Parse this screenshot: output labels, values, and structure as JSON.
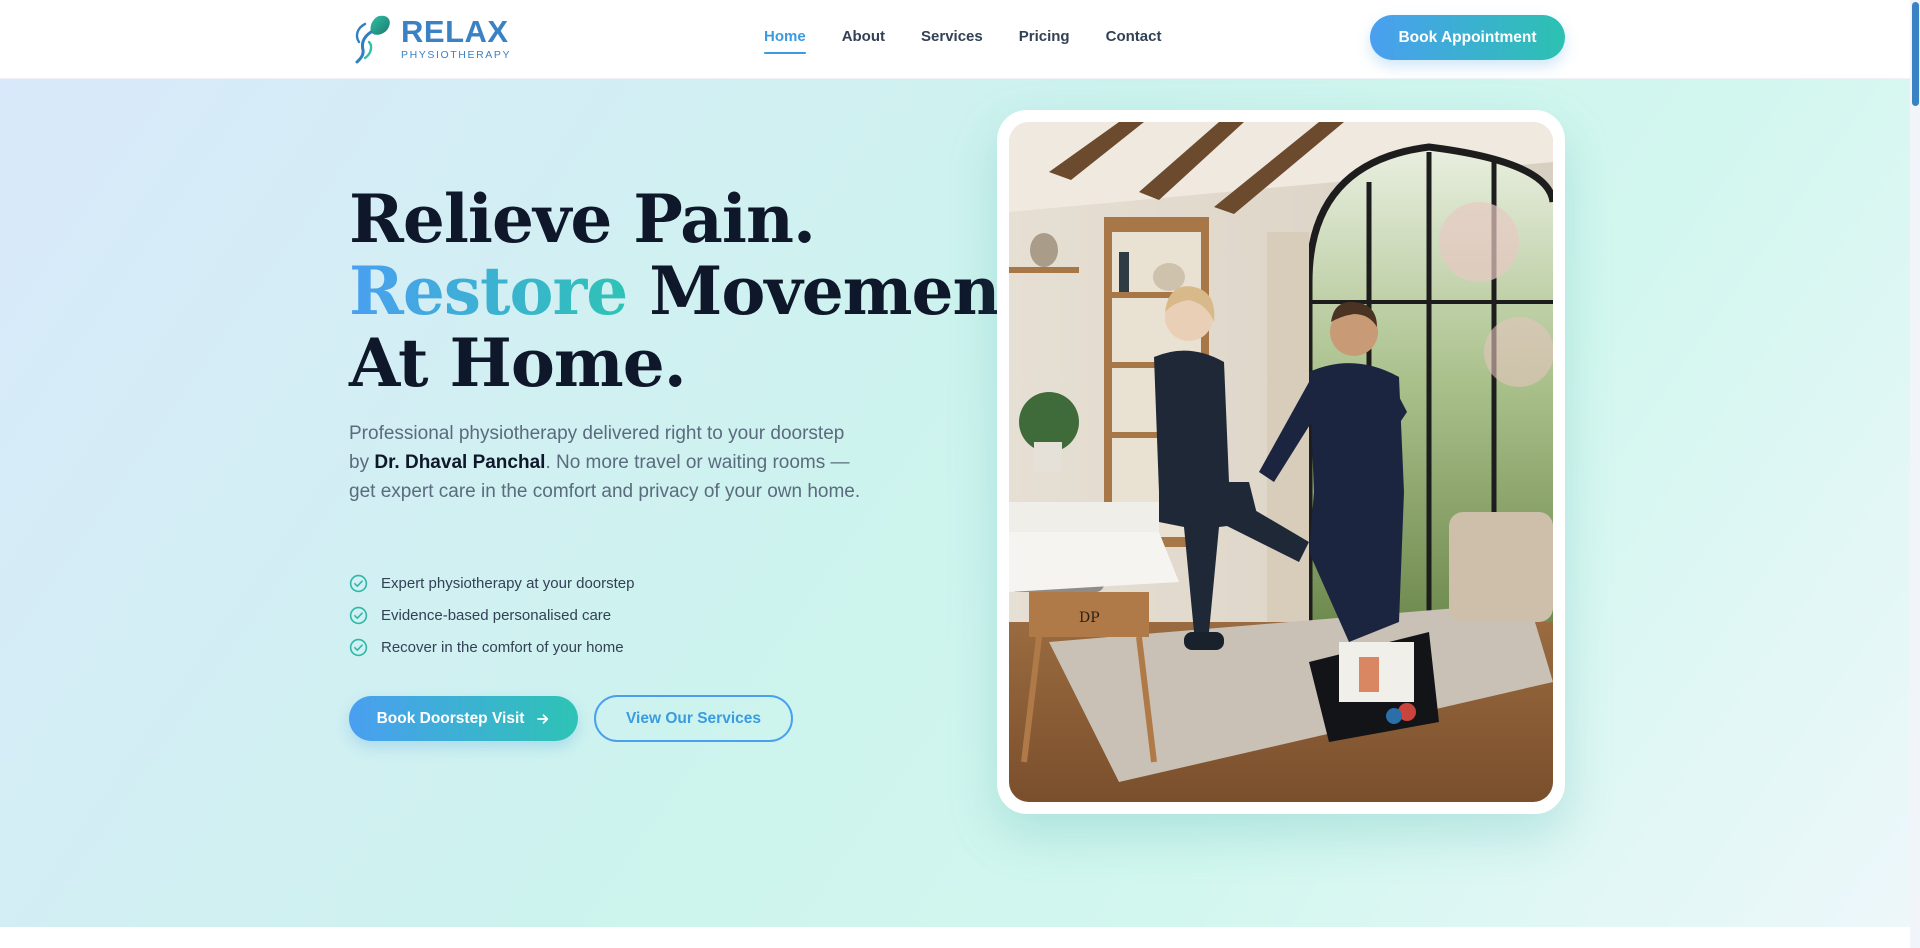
{
  "brand": {
    "name": "RELAX",
    "subtitle": "PHYSIOTHERAPY",
    "primary_color": "#3b82c4",
    "gradient_from": "#4a9ff0",
    "gradient_to": "#2ec3b5"
  },
  "nav": {
    "items": [
      {
        "label": "Home",
        "active": true
      },
      {
        "label": "About",
        "active": false
      },
      {
        "label": "Services",
        "active": false
      },
      {
        "label": "Pricing",
        "active": false
      },
      {
        "label": "Contact",
        "active": false
      }
    ],
    "cta_label": "Book Appointment"
  },
  "hero": {
    "headline_line1": "Relieve Pain.",
    "headline_accent": "Restore",
    "headline_line2_rest": " Movement.",
    "headline_line3": "At Home.",
    "lead_part1": "Professional physiotherapy delivered right to your doorstep by ",
    "lead_doctor": "Dr. Dhaval Panchal",
    "lead_part2": ". No more travel or waiting rooms — get expert care in the comfort and privacy of your own home.",
    "checks": [
      "Expert physiotherapy at your doorstep",
      "Evidence-based personalised care",
      "Recover in the comfort of your home"
    ],
    "primary_button": "Book Doorstep Visit",
    "secondary_button": "View Our Services",
    "check_icon": "check-circle-icon",
    "arrow_icon": "arrow-right-icon"
  },
  "photo": {
    "description_icon": "home-physio-session-photo",
    "table_mark": "DP"
  }
}
